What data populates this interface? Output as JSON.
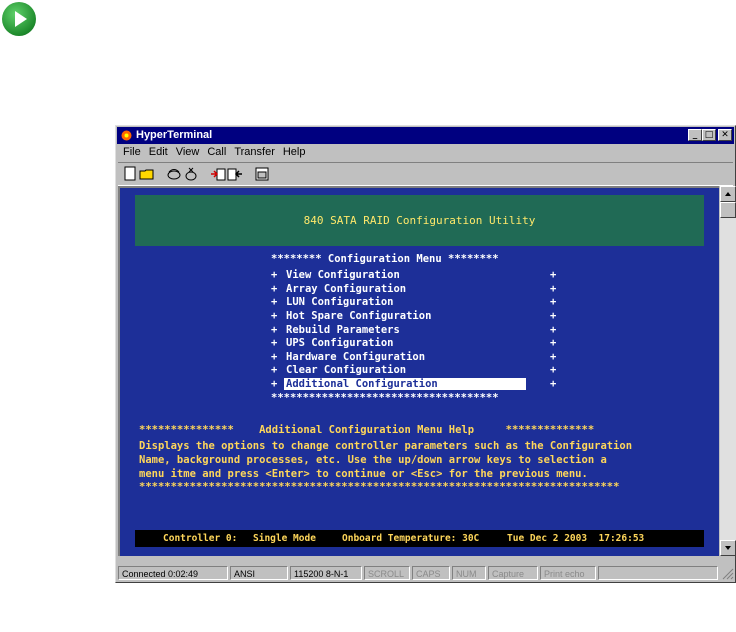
{
  "window": {
    "title": "HyperTerminal",
    "controls": {
      "minimize": "_",
      "maximize": "□",
      "close": "✕"
    }
  },
  "menubar": [
    "File",
    "Edit",
    "View",
    "Call",
    "Transfer",
    "Help"
  ],
  "toolbar_icons": [
    "new-icon",
    "open-icon",
    "connect-icon",
    "disconnect-icon",
    "send-icon",
    "receive-icon",
    "properties-icon"
  ],
  "terminal": {
    "header": "840 SATA RAID Configuration Utility",
    "menu_title": "******** Configuration Menu ********",
    "menu_items": [
      "View Configuration",
      "Array Configuration",
      "LUN Configuration",
      "Hot Spare Configuration",
      "Rebuild Parameters",
      "UPS Configuration",
      "Hardware Configuration",
      "Clear Configuration",
      "Additional Configuration"
    ],
    "selected_index": 8,
    "menu_bottom": "************************************",
    "help": {
      "title_line": "***************    Additional Configuration Menu Help     **************",
      "lines": [
        "Displays the options to change controller parameters such as the Configuration",
        "Name, background processes, etc. Use the up/down arrow keys to selection a",
        "menu itme and press <Enter> to continue or <Esc> for the previous menu.",
        "****************************************************************************"
      ]
    },
    "status": {
      "controller": "Controller 0:",
      "mode": "Single Mode",
      "temperature": "Onboard Temperature: 30C",
      "datetime": "Tue Dec 2 2003  17:26:53"
    }
  },
  "statusbar": {
    "connected": "Connected 0:02:49",
    "emulation": "ANSI",
    "settings": "115200 8-N-1",
    "scroll": "SCROLL",
    "caps": "CAPS",
    "num": "NUM",
    "capture": "Capture",
    "print_echo": "Print echo"
  },
  "colors": {
    "terminal_bg": "#1d2f98",
    "header_bg": "#206a55",
    "header_text": "#ffe86a",
    "help_text": "#ffd75a",
    "titlebar": "#000080"
  }
}
